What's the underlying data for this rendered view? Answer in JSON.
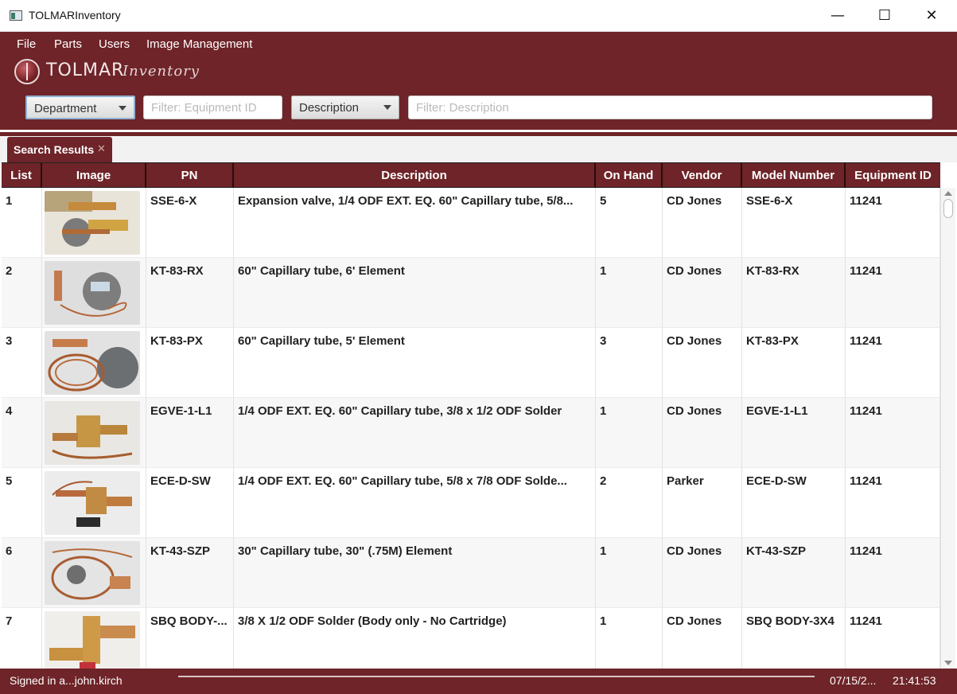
{
  "window": {
    "title": "TOLMARInventory",
    "minimize_glyph": "—",
    "maximize_glyph": "☐",
    "close_glyph": "✕"
  },
  "menu": [
    "File",
    "Parts",
    "Users",
    "Image Management"
  ],
  "logo": {
    "main": "TOLMAR",
    "sub": "Inventory"
  },
  "filters": {
    "department_label": "Department",
    "equipment_placeholder": "Filter: Equipment ID",
    "description_label": "Description",
    "description_placeholder": "Filter: Description"
  },
  "tab": {
    "label": "Search Results",
    "close_glyph": "✕"
  },
  "columns": [
    "List",
    "Image",
    "PN",
    "Description",
    "On Hand",
    "Vendor",
    "Model Number",
    "Equipment ID"
  ],
  "rows": [
    {
      "list": "1",
      "pn": "SSE-6-X",
      "description": "Expansion valve, 1/4 ODF EXT. EQ. 60\" Capillary tube, 5/8...",
      "on_hand": "5",
      "vendor": "CD Jones",
      "model": "SSE-6-X",
      "equipment_id": "11241"
    },
    {
      "list": "2",
      "pn": "KT-83-RX",
      "description": "60\" Capillary tube, 6' Element",
      "on_hand": "1",
      "vendor": "CD Jones",
      "model": "KT-83-RX",
      "equipment_id": "11241"
    },
    {
      "list": "3",
      "pn": "KT-83-PX",
      "description": "60\" Capillary tube, 5' Element",
      "on_hand": "3",
      "vendor": "CD Jones",
      "model": "KT-83-PX",
      "equipment_id": "11241"
    },
    {
      "list": "4",
      "pn": "EGVE-1-L1",
      "description": "1/4 ODF EXT. EQ. 60\" Capillary tube, 3/8 x 1/2 ODF Solder",
      "on_hand": "1",
      "vendor": "CD Jones",
      "model": "EGVE-1-L1",
      "equipment_id": "11241"
    },
    {
      "list": "5",
      "pn": "ECE-D-SW",
      "description": "1/4 ODF EXT. EQ. 60\" Capillary tube, 5/8 x 7/8 ODF Solde...",
      "on_hand": "2",
      "vendor": "Parker",
      "model": "ECE-D-SW",
      "equipment_id": "11241"
    },
    {
      "list": "6",
      "pn": "KT-43-SZP",
      "description": "30\" Capillary tube, 30\" (.75M) Element",
      "on_hand": "1",
      "vendor": "CD Jones",
      "model": "KT-43-SZP",
      "equipment_id": "11241"
    },
    {
      "list": "7",
      "pn": "SBQ BODY-...",
      "description": "3/8 X 1/2 ODF Solder (Body only - No Cartridge)",
      "on_hand": "1",
      "vendor": "CD Jones",
      "model": "SBQ BODY-3X4",
      "equipment_id": "11241"
    }
  ],
  "status": {
    "user": "Signed in a...john.kirch",
    "date": "07/15/2...",
    "time": "21:41:53"
  },
  "colors": {
    "brand": "#6e2428",
    "header_text": "#ffffff"
  }
}
